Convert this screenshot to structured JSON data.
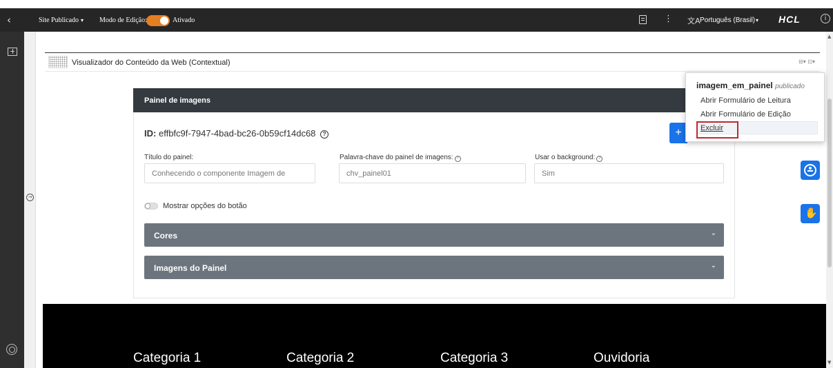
{
  "toolbar": {
    "back": "‹",
    "site_label": "Site Publicado",
    "mode_label": "Modo de Edição:",
    "mode_state": "Ativado",
    "language_icon": "文A",
    "language": "Português (Brasil)",
    "brand": "HCL",
    "info": "i",
    "kebab": "⋮",
    "caret": "▾"
  },
  "left": {
    "expand_arrow": "→"
  },
  "portlet": {
    "title": "Visualizador do Conteúdo da Web (Contextual)",
    "menu_icon": "⊟▾ ⊡▾"
  },
  "panel": {
    "header": "Painel de imagens",
    "id_label": "ID:",
    "id_value": "effbfc9f-7947-4bad-bc26-0b59cf14dc68",
    "add_label": "+",
    "help": "?",
    "fields": [
      {
        "label": "Título do painel:",
        "value": "Conhecendo o  componente Imagem de"
      },
      {
        "label": "Palavra-chave do painel de imagens:",
        "value": "chv_painel01"
      },
      {
        "label": "Usar o background:",
        "value": "Sim"
      }
    ],
    "switch_label": "Mostrar opções do botão",
    "accordions": [
      {
        "label": "Cores",
        "chevron": "⌄"
      },
      {
        "label": "Imagens do Painel",
        "chevron": "⌄"
      }
    ]
  },
  "dropdown": {
    "title_name": "imagem_em_painel",
    "title_status": "publicado",
    "items": [
      "Abrir Formulário de Leitura",
      "Abrir Formulário de Edição",
      "Excluir"
    ]
  },
  "accessibility": {
    "sign_icon": "✋"
  },
  "scroll": {
    "up": "▲",
    "down": "▼"
  },
  "footer": {
    "categories": [
      "Categoria 1",
      "Categoria 2",
      "Categoria 3",
      "Ouvidoria"
    ]
  },
  "colors": {
    "toolbar_bg": "#262626",
    "toggle_on": "#e67e22",
    "panel_header": "#343a40",
    "accordion": "#6c757d",
    "primary": "#1a73e8",
    "highlight_box": "#c0282d"
  }
}
